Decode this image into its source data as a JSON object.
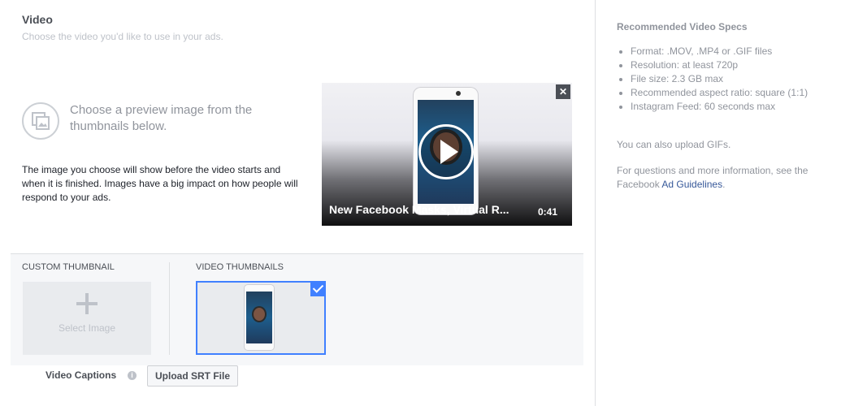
{
  "header": {
    "title": "Video",
    "subtitle": "Choose the video you'd like to use in your ads."
  },
  "preview": {
    "heading": "Choose a preview image from the thumbnails below.",
    "description": "The image you choose will show before the video starts and when it is finished. Images have a big impact on how people will respond to your ads."
  },
  "video": {
    "title": "New Facebook Masks, Virtual R...",
    "duration": "0:41",
    "close": "✕"
  },
  "thumbnails": {
    "custom_label": "CUSTOM THUMBNAIL",
    "select_image": "Select Image",
    "video_label": "VIDEO THUMBNAILS"
  },
  "captions": {
    "label": "Video Captions",
    "info": "i",
    "upload_button": "Upload SRT File"
  },
  "specs": {
    "title": "Recommended Video Specs",
    "items": [
      "Format: .MOV, .MP4 or .GIF files",
      "Resolution: at least 720p",
      "File size: 2.3 GB max",
      "Recommended aspect ratio: square (1:1)",
      "Instagram Feed: 60 seconds max"
    ],
    "gifs": "You can also upload GIFs.",
    "more_prefix": "For questions and more information, see the Facebook ",
    "more_link": "Ad Guidelines",
    "more_suffix": "."
  },
  "colors": {
    "accent": "#4080ff",
    "link": "#365899"
  }
}
